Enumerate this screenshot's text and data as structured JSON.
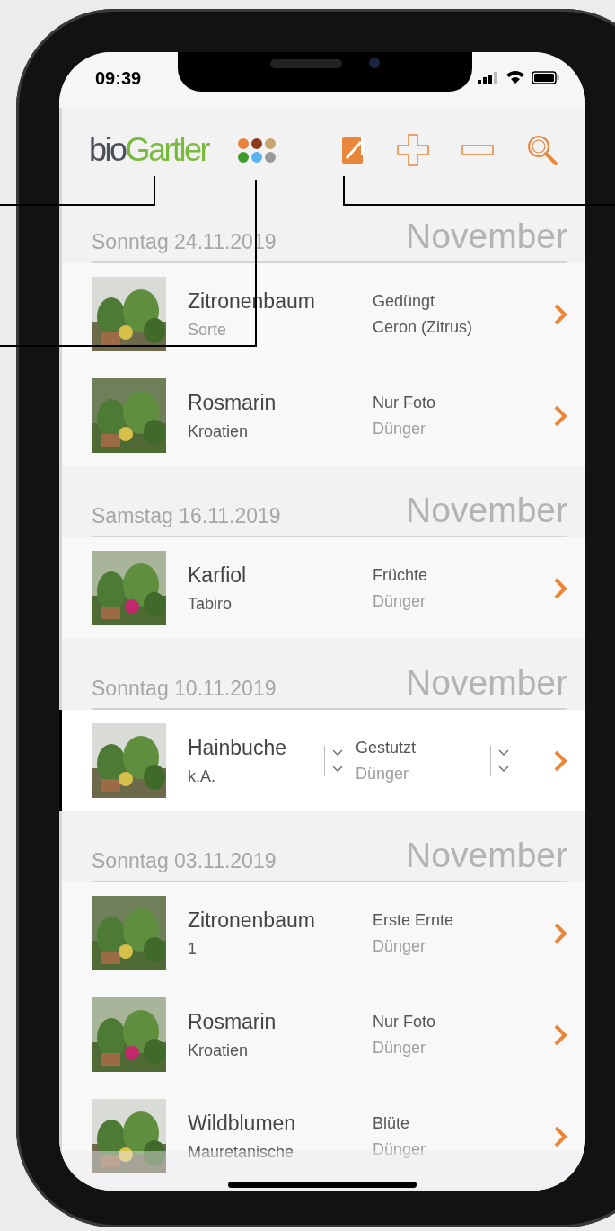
{
  "status_bar": {
    "time": "09:39"
  },
  "header": {
    "logo_part_1": "bio",
    "logo_part_2": "Gartler",
    "palette": [
      {
        "color": "#e8833a"
      },
      {
        "color": "#8b3a1a"
      },
      {
        "color": "#c8a46e"
      },
      {
        "color": "#3f9a2e"
      },
      {
        "color": "#5ab4f0"
      },
      {
        "color": "#9a9a9a"
      }
    ]
  },
  "groups": [
    {
      "date": "Sonntag 24.11.2019",
      "month": "November",
      "entries": [
        {
          "kind": "view",
          "selected": false,
          "name": "Zitronenbaum",
          "variety_placeholder": "Sorte",
          "activity": "Gedüngt",
          "fertilizer": "Ceron (Zitrus)"
        },
        {
          "kind": "view",
          "selected": false,
          "name": "Rosmarin",
          "variety": "Kroatien",
          "activity": "Nur Foto",
          "fertilizer_placeholder": "Dünger"
        }
      ]
    },
    {
      "date": "Samstag 16.11.2019",
      "month": "November",
      "entries": [
        {
          "kind": "view",
          "selected": false,
          "name": "Karfiol",
          "variety": "Tabiro",
          "activity": "Früchte",
          "fertilizer_placeholder": "Dünger"
        }
      ]
    },
    {
      "date": "Sonntag 10.11.2019",
      "month": "November",
      "entries": [
        {
          "kind": "edit",
          "selected": true,
          "name": "Hainbuche",
          "variety": "k.A.",
          "activity": "Gestutzt",
          "fertilizer_placeholder": "Dünger"
        }
      ]
    },
    {
      "date": "Sonntag 03.11.2019",
      "month": "November",
      "entries": [
        {
          "kind": "view",
          "selected": false,
          "name": "Zitronenbaum",
          "variety": "1",
          "activity": "Erste Ernte",
          "fertilizer_placeholder": "Dünger"
        },
        {
          "kind": "view",
          "selected": false,
          "name": "Rosmarin",
          "variety": "Kroatien",
          "activity": "Nur Foto",
          "fertilizer_placeholder": "Dünger"
        },
        {
          "kind": "view",
          "selected": false,
          "name": "Wildblumen",
          "variety": "Mauretanische",
          "activity": "Blüte",
          "fertilizer_placeholder": "Dünger"
        }
      ]
    }
  ]
}
